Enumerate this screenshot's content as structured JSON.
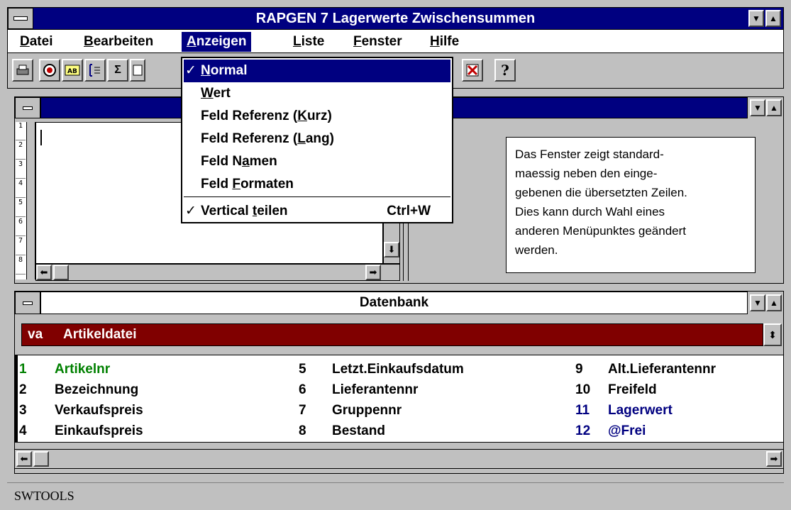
{
  "app": {
    "title": "RAPGEN 7 Lagerwerte Zwischensummen"
  },
  "menubar": {
    "items": [
      {
        "label": "Datei"
      },
      {
        "label": "Bearbeiten"
      },
      {
        "label": "Anzeigen"
      },
      {
        "label": "Liste"
      },
      {
        "label": "Fenster"
      },
      {
        "label": "Hilfe"
      }
    ]
  },
  "toolbar": {
    "buttons": [
      "printer-icon",
      "record-icon",
      "ab-icon",
      "list-icon",
      "sum-icon",
      "form-icon",
      "cancel-icon",
      "help-icon"
    ],
    "sum_label": "Σ",
    "help_label": "?"
  },
  "anzeigen_menu": {
    "items": [
      {
        "label": "Normal",
        "checked": true,
        "selected": true
      },
      {
        "label": "Wert"
      },
      {
        "label": "Feld Referenz (Kurz)"
      },
      {
        "label": "Feld Referenz (Lang)"
      },
      {
        "label": "Feld Namen"
      },
      {
        "label": "Feld Formaten"
      }
    ],
    "split": {
      "label": "Vertical teilen",
      "checked": true,
      "shortcut": "Ctrl+W"
    },
    "checkmark": "✓"
  },
  "editor": {
    "line_numbers": [
      "1",
      "2",
      "3",
      "4",
      "5",
      "6",
      "7",
      "8"
    ]
  },
  "info": {
    "text": "Das Fenster zeigt standard-maessig neben den einge-gebenen die übersetzten Zeilen. Dies kann durch Wahl eines anderen Menüpunktes geändert werden.",
    "lines": [
      "Das Fenster zeigt standard-",
      "maessig neben den einge-",
      "gebenen die übersetzten Zeilen.",
      "Dies kann durch Wahl eines",
      "anderen Menüpunktes geändert",
      "werden."
    ]
  },
  "database": {
    "title": "Datenbank",
    "selected_code": "va",
    "selected_name": "Artikeldatei",
    "fields": [
      {
        "num": "1",
        "name": "Artikelnr",
        "color": "#008000"
      },
      {
        "num": "2",
        "name": "Bezeichnung",
        "color": "#000000"
      },
      {
        "num": "3",
        "name": "Verkaufspreis",
        "color": "#000000"
      },
      {
        "num": "4",
        "name": "Einkaufspreis",
        "color": "#000000"
      },
      {
        "num": "5",
        "name": "Letzt.Einkaufsdatum",
        "color": "#000000"
      },
      {
        "num": "6",
        "name": "Lieferantennr",
        "color": "#000000"
      },
      {
        "num": "7",
        "name": "Gruppennr",
        "color": "#000000"
      },
      {
        "num": "8",
        "name": "Bestand",
        "color": "#000000"
      },
      {
        "num": "9",
        "name": "Alt.Lieferantennr",
        "color": "#000000"
      },
      {
        "num": "10",
        "name": "Freifeld",
        "color": "#000000"
      },
      {
        "num": "11",
        "name": "Lagerwert",
        "color": "#000080"
      },
      {
        "num": "12",
        "name": "@Frei",
        "color": "#000080"
      }
    ]
  },
  "status": {
    "text": "SWTOOLS"
  },
  "colors": {
    "title_bar": "#000080",
    "menu_highlight": "#000080",
    "db_select": "#800000",
    "face": "#c0c0c0"
  }
}
